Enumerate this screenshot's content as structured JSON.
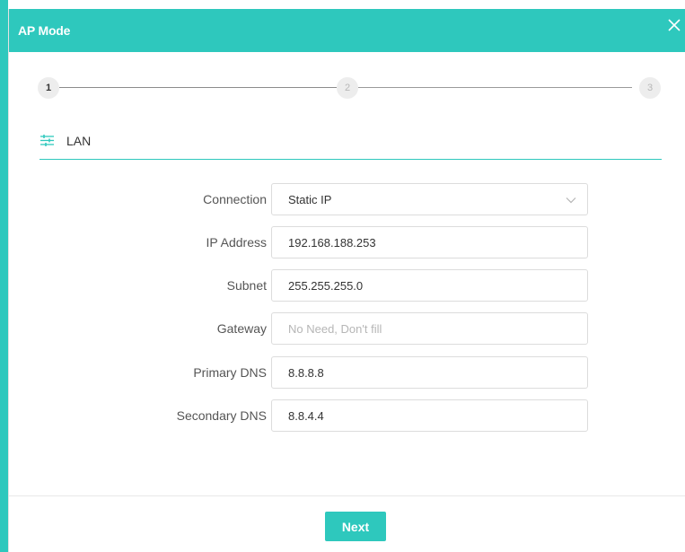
{
  "modal": {
    "title": "AP Mode"
  },
  "stepper": {
    "steps": [
      "1",
      "2",
      "3"
    ]
  },
  "section": {
    "title": "LAN"
  },
  "form": {
    "connection": {
      "label": "Connection",
      "value": "Static IP"
    },
    "ip_address": {
      "label": "IP Address",
      "value": "192.168.188.253"
    },
    "subnet": {
      "label": "Subnet",
      "value": "255.255.255.0"
    },
    "gateway": {
      "label": "Gateway",
      "value": "",
      "placeholder": "No Need, Don't fill"
    },
    "primary_dns": {
      "label": "Primary DNS",
      "value": "8.8.8.8"
    },
    "secondary_dns": {
      "label": "Secondary DNS",
      "value": "8.8.4.4"
    }
  },
  "footer": {
    "next_label": "Next"
  },
  "colors": {
    "accent": "#2ec8bd"
  },
  "icons": {
    "close": "close-icon",
    "section": "sliders-icon",
    "select": "chevron-down-icon"
  }
}
